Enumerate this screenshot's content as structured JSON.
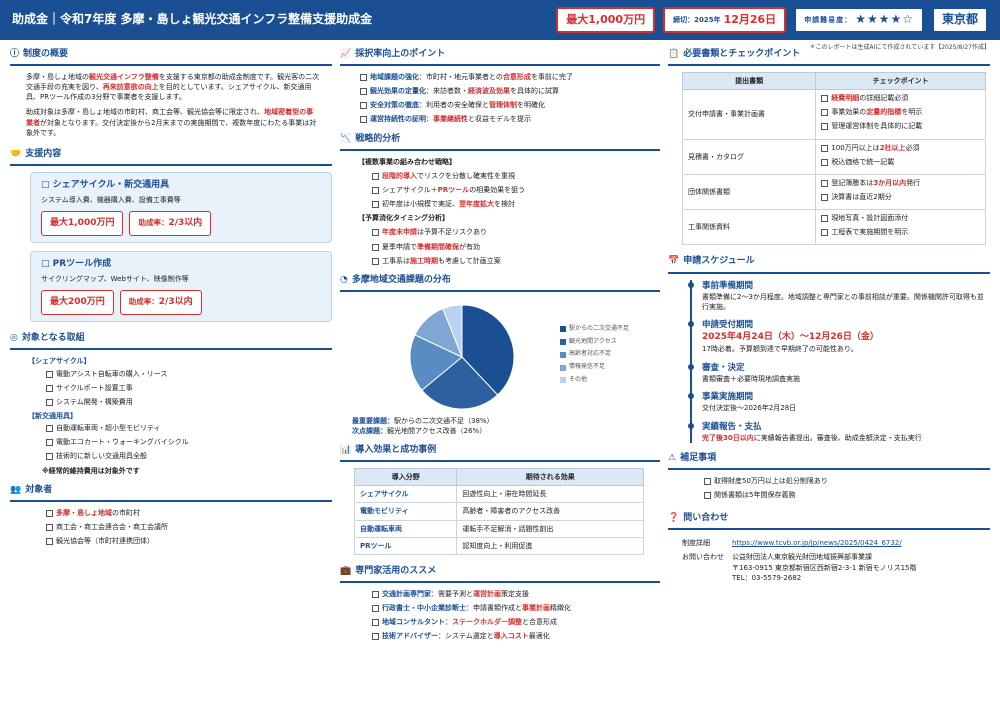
{
  "header": {
    "title": "助成金｜令和7年度 多摩・島しょ観光交通インフラ整備支援助成金",
    "max": "最大1,000万円",
    "deadline_label": "締切：2025年",
    "deadline_value": "12月26日",
    "difficulty_label": "申請難易度：",
    "difficulty_stars": "★★★★☆",
    "area": "東京都"
  },
  "note": "＊このレポートは生成AIにて作成されています【2025/8/27作成】",
  "overview": {
    "title": "制度の概要",
    "p1a": "多摩・島しょ地域の",
    "p1b": "観光交通インフラ整備",
    "p1c": "を支援する東京都の助成金制度です。観光客の二次交通手段の充実を図り、",
    "p1d": "再来訪意欲の向上",
    "p1e": "を目的としています。シェアサイクル、新交通用具、PRツール作成の3分野で事業者を支援します。",
    "p2a": "助成対象は多摩・島しょ地域の市町村、商工会等、観光協会等に限定され、",
    "p2b": "地域密着型の事業者",
    "p2c": "が対象となります。交付決定後から2月末までの実施期間で、複数年度にわたる事業は対象外です。"
  },
  "support": {
    "title": "支援内容",
    "cards": [
      {
        "title": "□ シェアサイクル・新交通用具",
        "desc": "システム導入費、機器購入費、設備工事費等",
        "max": "最大1,000万円",
        "rate_label": "助成率：",
        "rate": "2/3以内"
      },
      {
        "title": "□ PRツール作成",
        "desc": "サイクリングマップ、Webサイト、映像制作等",
        "max": "最大200万円",
        "rate_label": "助成率：",
        "rate": "2/3以内"
      }
    ]
  },
  "targets": {
    "title": "対象となる取組",
    "g1": "【シェアサイクル】",
    "g1items": [
      "電動アシスト自転車の購入・リース",
      "サイクルポート設置工事",
      "システム開発・構築費用"
    ],
    "g2": "【新交通用具】",
    "g2items": [
      "自動運転車両・超小型モビリティ",
      "電動エコカート・ウォーキングバイシクル",
      "技術的に新しい交通用具全般"
    ],
    "note": "※経常的維持費用は対象外です"
  },
  "eligible": {
    "title": "対象者",
    "i1a": "多摩・島しょ地域",
    "i1b": "の市町村",
    "i2": "商工会・商工会連合会・商工会議所",
    "i3": "観光協会等（市町村連携団体）"
  },
  "points": {
    "title": "採択率向上のポイント",
    "items": [
      {
        "k": "地域課題の強化",
        "t1": "：市町村・地元事業者との",
        "r": "合意形成",
        "t2": "を事前に完了"
      },
      {
        "k": "観光効果の定量化",
        "t1": "：来訪者数・",
        "r": "経済波及効果",
        "t2": "を具体的に試算"
      },
      {
        "k": "安全対策の徹底",
        "t1": "：利用者の安全確保と",
        "r": "管理体制",
        "t2": "を明確化"
      },
      {
        "k": "運営持続性の証明",
        "t1": "：",
        "r": "事業継続性",
        "t2": "と収益モデルを提示"
      }
    ]
  },
  "strategy": {
    "title": "戦略的分析",
    "h1": "【複数事業の組み合わせ戦略】",
    "s1": [
      {
        "a": "",
        "r": "段階的導入",
        "b": "でリスクを分散し確実性を重視"
      },
      {
        "a": "シェアサイクル＋",
        "r": "PRツール",
        "b": "の相乗効果を狙う"
      },
      {
        "a": "初年度は小規模で実証、",
        "r": "翌年度拡大",
        "b": "を検討"
      }
    ],
    "h2": "【予算消化タイミング分析】",
    "s2": [
      {
        "a": "",
        "r": "年度末申請",
        "b": "は予算不足リスクあり"
      },
      {
        "a": "夏季申請で",
        "r": "準備期間確保",
        "b": "が有効"
      },
      {
        "a": "工事系は",
        "r": "施工時期",
        "b": "も考慮して計画立案"
      }
    ]
  },
  "distribution": {
    "title": "多摩地域交通課題の分布",
    "main_label": "最重要課題：",
    "main_value": "駅からの二次交通不足（38%）",
    "second_label": "次点課題：",
    "second_value": "観光地間アクセス改善（26%）"
  },
  "chart_data": {
    "type": "pie",
    "categories": [
      "駅からの二次交通不足",
      "観光地間アクセス",
      "高齢者対応不足",
      "情報発信不足",
      "その他"
    ],
    "values": [
      38,
      26,
      18,
      12,
      6
    ],
    "colors": [
      "#1b4f93",
      "#2e5f9e",
      "#5a8cc4",
      "#7fa6d4",
      "#b8d3ef"
    ],
    "legend_position": "right"
  },
  "effects": {
    "title": "導入効果と成功事例",
    "h1": "導入分野",
    "h2": "期待される効果",
    "rows": [
      [
        "シェアサイクル",
        "回遊性向上・滞在時間延長"
      ],
      [
        "電動モビリティ",
        "高齢者・障害者のアクセス改善"
      ],
      [
        "自動運転車両",
        "運転手不足解消・話題性創出"
      ],
      [
        "PRツール",
        "認知度向上・利用促進"
      ]
    ]
  },
  "experts": {
    "title": "専門家活用のススメ",
    "items": [
      {
        "k": "交通計画専門家",
        "t1": "：需要予測と",
        "r": "運営計画",
        "t2": "策定支援"
      },
      {
        "k": "行政書士・中小企業診断士",
        "t1": "：申請書類作成と",
        "r": "事業計画",
        "t2": "精緻化"
      },
      {
        "k": "地域コンサルタント",
        "t1": "：",
        "r": "ステークホルダー調整",
        "t2": "と合意形成"
      },
      {
        "k": "技術アドバイザー",
        "t1": "：システム選定と",
        "r": "導入コスト",
        "t2": "最適化"
      }
    ]
  },
  "docs": {
    "title": "必要書類とチェックポイント",
    "h1": "提出書類",
    "h2": "チェックポイント",
    "rows": [
      {
        "name": "交付申請書・事業計画書",
        "checks": [
          {
            "a": "",
            "r": "経費明細",
            "b": "の詳細記載必須"
          },
          {
            "a": "事業効果の",
            "r": "定量的指標",
            "b": "を明示"
          },
          {
            "a": "管理運営体制を具体的に記載",
            "r": "",
            "b": ""
          }
        ]
      },
      {
        "name": "見積書・カタログ",
        "checks": [
          {
            "a": "100万円以上は",
            "r": "2社以上",
            "b": "必須"
          },
          {
            "a": "税込価格で統一記載",
            "r": "",
            "b": ""
          }
        ]
      },
      {
        "name": "団体関係書類",
        "checks": [
          {
            "a": "登記簿謄本は",
            "r": "3か月以内",
            "b": "発行"
          },
          {
            "a": "決算書は直近2期分",
            "r": "",
            "b": ""
          }
        ]
      },
      {
        "name": "工事関係資料",
        "checks": [
          {
            "a": "現地写真・設計図面添付",
            "r": "",
            "b": ""
          },
          {
            "a": "工程表で実施期間を明示",
            "r": "",
            "b": ""
          }
        ]
      }
    ]
  },
  "schedule": {
    "title": "申請スケジュール",
    "items": [
      {
        "h": "事前準備期間",
        "big": "",
        "d": "書類準備に2～3か月程度。地域調整と専門家との事前相談が重要。関係機関許可取得も並行実施。",
        "r": ""
      },
      {
        "h": "申請受付期間",
        "big": "2025年4月24日（木）～12月26日（金）",
        "d": "17時必着。予算額到達で早期終了の可能性あり。",
        "r": ""
      },
      {
        "h": "審査・決定",
        "big": "",
        "d": "書類審査＋必要時現地調査実施",
        "r": ""
      },
      {
        "h": "事業実施期間",
        "big": "",
        "d": "交付決定後～2026年2月28日",
        "r": ""
      },
      {
        "h": "実績報告・支払",
        "big": "",
        "d": "に実績報告書提出。審査後、助成金額決定・支払実行",
        "r": "完了後30日以内"
      }
    ]
  },
  "extra": {
    "title": "補足事項",
    "items": [
      "取得財産50万円以上は処分制限あり",
      "関係書類は5年間保存義務"
    ]
  },
  "contact": {
    "title": "問い合わせ",
    "l1": "制度詳細",
    "url": "https://www.tcvb.or.jp/jp/news/2025/0424_6732/",
    "l2": "お問い合わせ",
    "org": "公益財団法人東京観光財団地域振興部事業課",
    "addr": "〒163-0915 東京都新宿区西新宿2-3-1 新宿モノリス15階",
    "tel": "TEL：03-5579-2682"
  }
}
